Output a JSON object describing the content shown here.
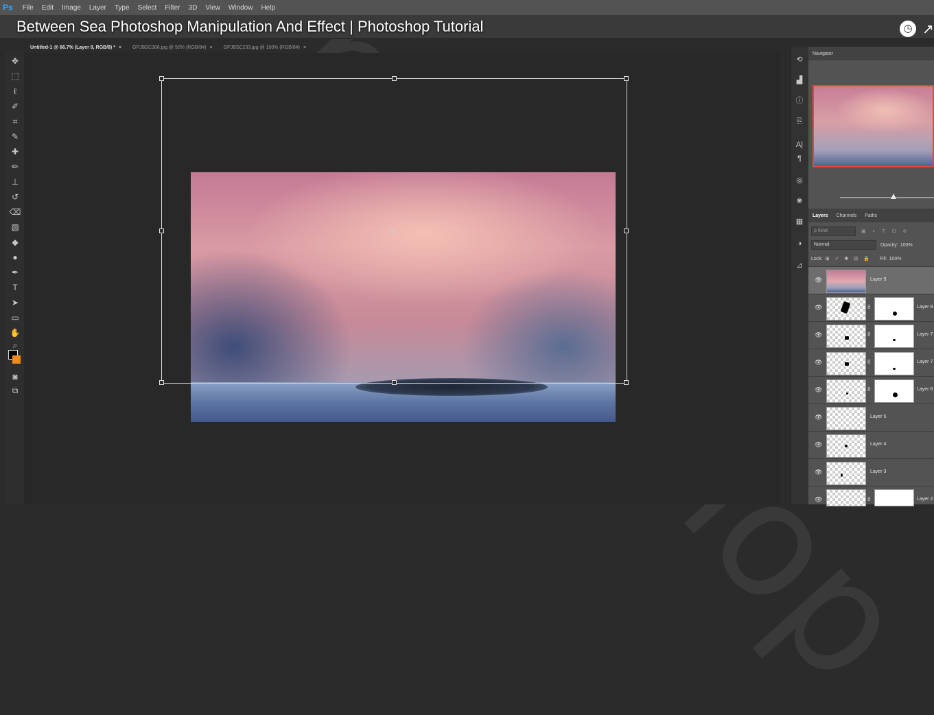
{
  "app": {
    "logo": "Ps"
  },
  "menu": [
    "File",
    "Edit",
    "Image",
    "Layer",
    "Type",
    "Select",
    "Filter",
    "3D",
    "View",
    "Window",
    "Help"
  ],
  "video_title": "Between Sea Photoshop Manipulation And Effect | Photoshop Tutorial",
  "tabs": [
    {
      "label": "Untitled-1 @ 66.7% (Layer 9, RGB/8) *",
      "close": "×"
    },
    {
      "label": "GPJBSC306.jpg @ 50% (RGB/8#)",
      "close": "×"
    },
    {
      "label": "GPJBSC233.jpg @ 100% (RGB/8#)",
      "close": "×"
    }
  ],
  "navigator": {
    "tab": "Navigator"
  },
  "layers_panel": {
    "tabs": [
      "Layers",
      "Channels",
      "Paths"
    ],
    "kind_placeholder": "ρ Kind",
    "filter_icons": "▣ ◐ T ⊡ ⊕",
    "blend_mode": "Normal",
    "opacity_label": "Opacity:",
    "opacity_value": "100%",
    "lock_label": "Lock:",
    "lock_icons": "⊞ ✓ ✥ ⊡ 🔒",
    "fill_label": "Fill:",
    "fill_value": "100%"
  },
  "layers": [
    {
      "name": "Layer 9",
      "selected": true
    },
    {
      "name": "Layer 8"
    },
    {
      "name": "Layer 7"
    },
    {
      "name": "Layer 7"
    },
    {
      "name": "Layer 6"
    },
    {
      "name": "Layer 5"
    },
    {
      "name": "Layer 4"
    },
    {
      "name": "Layer 3"
    },
    {
      "name": "Layer 2"
    }
  ],
  "colors": {
    "foreground": "#000000",
    "background": "#f08a18",
    "accent": "#e04a3a"
  }
}
